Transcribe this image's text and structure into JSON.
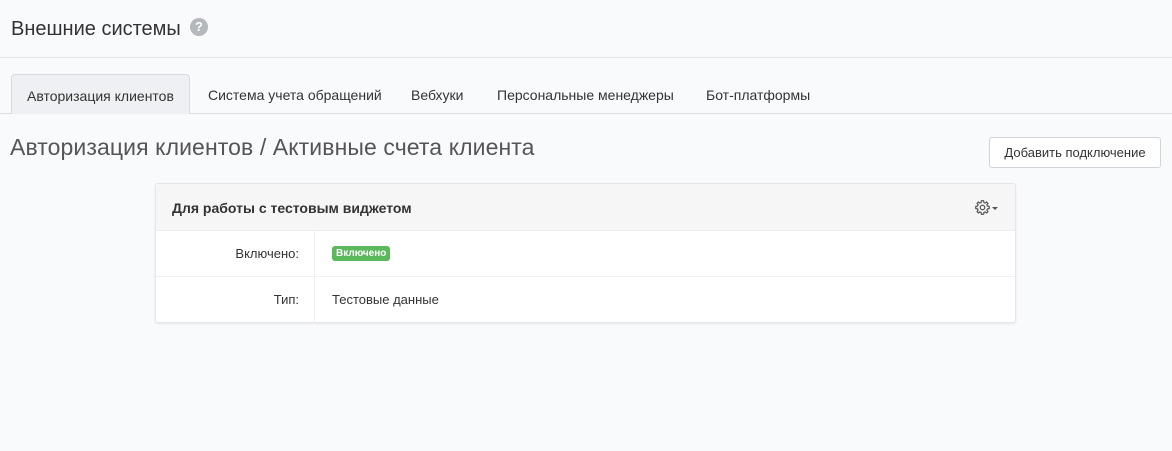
{
  "header": {
    "title": "Внешние системы",
    "help_icon": "question-circle-icon"
  },
  "tabs": [
    {
      "label": "Авторизация клиентов",
      "active": true
    },
    {
      "label": "Система учета обращений",
      "active": false
    },
    {
      "label": "Вебхуки",
      "active": false
    },
    {
      "label": "Персональные менеджеры",
      "active": false
    },
    {
      "label": "Бот-платформы",
      "active": false
    }
  ],
  "section": {
    "title": "Авторизация клиентов / Активные счета клиента",
    "add_button_label": "Добавить подключение"
  },
  "panel": {
    "title": "Для работы с тестовым виджетом",
    "settings_icon": "gear-icon",
    "rows": [
      {
        "label": "Включено:",
        "value": "Включено",
        "badge_color": "#5cb85c"
      },
      {
        "label": "Тип:",
        "value": "Тестовые данные"
      }
    ]
  }
}
